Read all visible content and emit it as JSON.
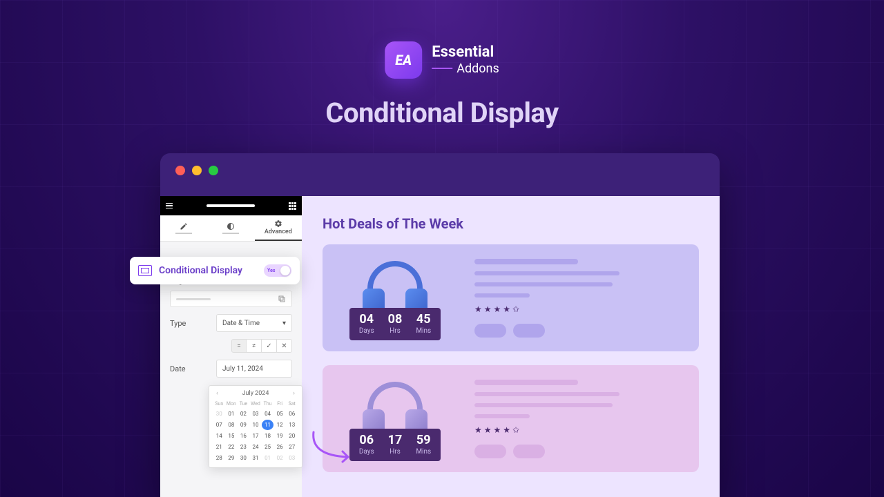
{
  "brand": {
    "initials": "EA",
    "name1": "Essential",
    "name2": "Addons"
  },
  "hero": {
    "title": "Conditional Display"
  },
  "editor": {
    "tabs": {
      "content": "",
      "style": "",
      "advanced": "Advanced"
    },
    "popup": {
      "label": "Conditional Display",
      "toggle_text": "Yes"
    },
    "logics_label": "Logics",
    "type_label": "Type",
    "type_value": "Date & Time",
    "date_label": "Date",
    "date_value": "July 11, 2024",
    "ops": {
      "eq": "=",
      "neq": "≠",
      "check": "✓",
      "close": "✕"
    }
  },
  "calendar": {
    "month": "July 2024",
    "dow": [
      "Sun",
      "Mon",
      "Tue",
      "Wed",
      "Thu",
      "Fri",
      "Sat"
    ],
    "lead": [
      "30"
    ],
    "days": [
      "01",
      "02",
      "03",
      "04",
      "05",
      "06",
      "07",
      "08",
      "09",
      "10",
      "11",
      "12",
      "13",
      "14",
      "15",
      "16",
      "17",
      "18",
      "19",
      "20",
      "21",
      "22",
      "23",
      "24",
      "25",
      "26",
      "27",
      "28",
      "29",
      "30",
      "31"
    ],
    "trail": [
      "01",
      "02",
      "03"
    ],
    "selected": "11"
  },
  "preview": {
    "title": "Hot Deals of The Week",
    "cards": [
      {
        "countdown": {
          "days": "04",
          "hrs": "08",
          "mins": "45"
        }
      },
      {
        "countdown": {
          "days": "06",
          "hrs": "17",
          "mins": "59"
        }
      }
    ],
    "labels": {
      "days": "Days",
      "hrs": "Hrs",
      "mins": "Mins"
    }
  }
}
